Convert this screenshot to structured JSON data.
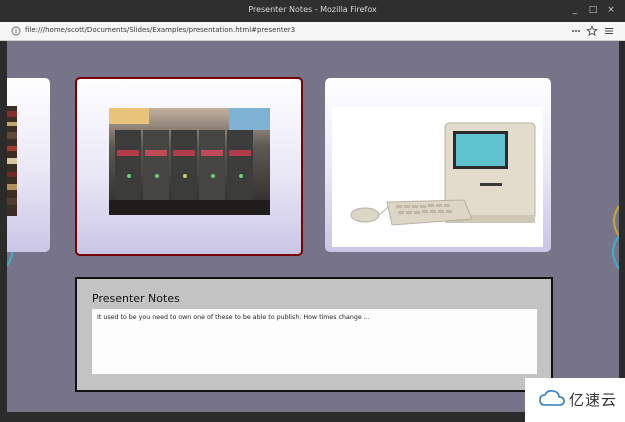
{
  "window": {
    "title": "Presenter Notes - Mozilla Firefox",
    "minimize": "_",
    "maximize": "□",
    "close": "×"
  },
  "browser": {
    "url": "file:///home/scott/Documents/Slides/Examples/presentation.html#presenter3",
    "page_actions_icon": "ellipsis-icon",
    "bookmark_icon": "star-icon",
    "menu_icon": "hamburger-icon"
  },
  "slides": [
    {
      "position": "previous",
      "image": "bookshelf-image"
    },
    {
      "position": "current",
      "image": "printing-press-image"
    },
    {
      "position": "next",
      "image": "macintosh-computer-image"
    }
  ],
  "notes": {
    "heading": "Presenter Notes",
    "text": "It used to be you need to own one of these to be able to publish. How times change ..."
  },
  "watermark": {
    "text": "亿速云"
  },
  "colors": {
    "background": "#77748a",
    "current_slide_border": "#7a0000",
    "notes_panel": "#c3c3c3"
  }
}
